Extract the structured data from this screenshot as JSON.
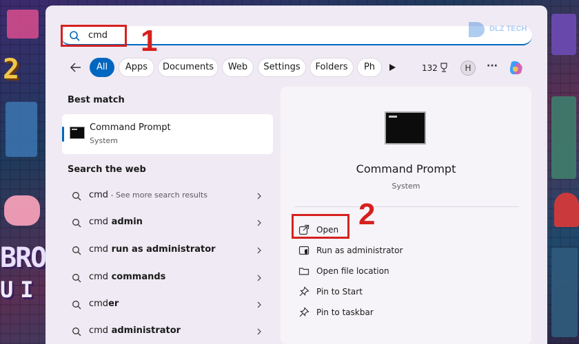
{
  "background_text": {
    "left_top": "2",
    "left_mid": "BROS",
    "left_bottom": "UI"
  },
  "search": {
    "value": "cmd"
  },
  "annotations": {
    "step1": "1",
    "step2": "2"
  },
  "filters": {
    "chips": [
      "All",
      "Apps",
      "Documents",
      "Web",
      "Settings",
      "Folders",
      "Ph"
    ],
    "active": "All",
    "count": "132",
    "avatar_initial": "H",
    "more": "···"
  },
  "best_match": {
    "heading": "Best match",
    "title": "Command Prompt",
    "subtitle": "System"
  },
  "search_web": {
    "heading": "Search the web",
    "items": [
      {
        "prefix": "cmd",
        "suffix": "",
        "hint": " - See more search results"
      },
      {
        "prefix": "cmd",
        "suffix": " admin",
        "hint": ""
      },
      {
        "prefix": "cmd",
        "suffix": " run as administrator",
        "hint": ""
      },
      {
        "prefix": "cmd",
        "suffix": " commands",
        "hint": ""
      },
      {
        "prefix": "cmd",
        "suffix": "er",
        "hint": ""
      },
      {
        "prefix": "cmd",
        "suffix": " administrator",
        "hint": ""
      }
    ]
  },
  "preview": {
    "title": "Command Prompt",
    "subtitle": "System",
    "actions": [
      "Open",
      "Run as administrator",
      "Open file location",
      "Pin to Start",
      "Pin to taskbar"
    ]
  },
  "colors": {
    "accent": "#0067c0",
    "annotation_red": "#d6201f",
    "panel": "#efeaf3"
  },
  "icons": {
    "search": "search-icon",
    "back": "back-arrow-icon",
    "play": "play-icon",
    "trophy": "trophy-icon",
    "copilot": "copilot-icon",
    "open": "open-external-icon",
    "run_admin": "shield-icon",
    "folder": "folder-icon",
    "pin": "pin-icon",
    "chevron": "chevron-right-icon"
  }
}
